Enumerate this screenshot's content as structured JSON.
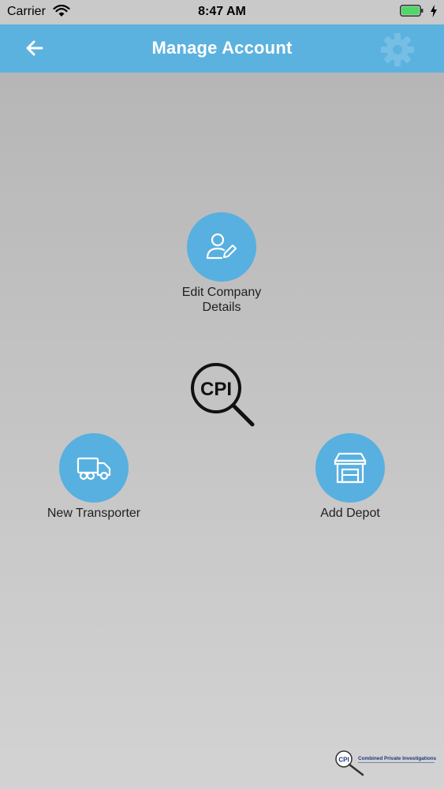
{
  "status_bar": {
    "carrier": "Carrier",
    "time": "8:47 AM",
    "battery_color": "#4cd964"
  },
  "nav": {
    "title": "Manage Account",
    "back_icon": "arrow-left-icon",
    "settings_icon": "gear-icon",
    "bar_color": "#5cb2df"
  },
  "actions": [
    {
      "label": "Edit Company Details",
      "icon": "user-edit-icon"
    },
    {
      "label": "New Transporter",
      "icon": "truck-icon"
    },
    {
      "label": "Add Depot",
      "icon": "depot-icon"
    }
  ],
  "center_logo": {
    "text": "CPI"
  },
  "footer_logo": {
    "badge": "CPI",
    "company": "Combined Private Investigations"
  },
  "accent_color": "#57b0e0"
}
